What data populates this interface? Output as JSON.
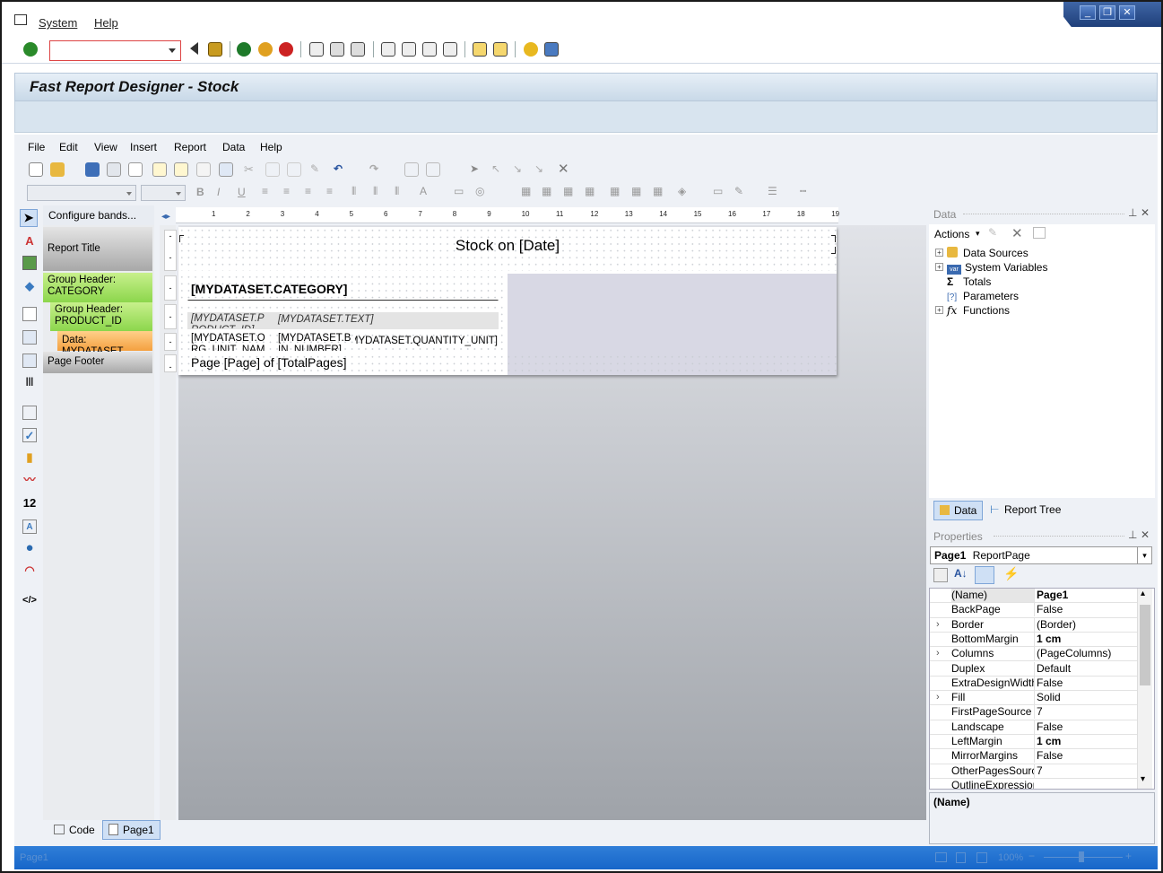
{
  "sap": {
    "menu": [
      "System",
      "Help"
    ],
    "command_field_value": ""
  },
  "window_title": "Fast Report Designer - Stock",
  "designer_menu": [
    "File",
    "Edit",
    "View",
    "Insert",
    "Report",
    "Data",
    "Help"
  ],
  "bands_header": "Configure bands...",
  "bands": [
    {
      "label": "Report Title"
    },
    {
      "label": "Group Header: CATEGORY"
    },
    {
      "label": "Group Header: PRODUCT_ID"
    },
    {
      "label": "Data: MYDATASET"
    },
    {
      "label": "Page Footer"
    }
  ],
  "ruler_numbers": [
    "1",
    "2",
    "3",
    "4",
    "5",
    "6",
    "7",
    "8",
    "9",
    "10",
    "11",
    "12",
    "13",
    "14",
    "15",
    "16",
    "17",
    "18",
    "19"
  ],
  "report": {
    "title_text": "Stock on [Date]",
    "category_text": "[MYDATASET.CATEGORY]",
    "product_id_text": "[MYDATASET.PRODUCT_ID]",
    "product_text": "[MYDATASET.TEXT]",
    "org_unit_text": "[MYDATASET.ORG_UNIT_NAME]",
    "bin_text": "[MYDATASET.BIN_NUMBER]",
    "qty_text": "[MYDATASET.QUANTITY_UNIT]",
    "footer_text": "Page [Page] of [TotalPages]"
  },
  "data_panel": {
    "title": "Data",
    "actions_label": "Actions",
    "tree": [
      "Data Sources",
      "System Variables",
      "Totals",
      "Parameters",
      "Functions"
    ],
    "tabs": [
      "Data",
      "Report Tree"
    ]
  },
  "properties_panel": {
    "title": "Properties",
    "selected_object": "Page1",
    "selected_type": "ReportPage",
    "rows": [
      {
        "name": "(Name)",
        "value": "Page1",
        "bold": true,
        "expand": false
      },
      {
        "name": "BackPage",
        "value": "False",
        "bold": false,
        "expand": false
      },
      {
        "name": "Border",
        "value": "(Border)",
        "bold": false,
        "expand": true
      },
      {
        "name": "BottomMargin",
        "value": "1 cm",
        "bold": true,
        "expand": false
      },
      {
        "name": "Columns",
        "value": "(PageColumns)",
        "bold": false,
        "expand": true
      },
      {
        "name": "Duplex",
        "value": "Default",
        "bold": false,
        "expand": false
      },
      {
        "name": "ExtraDesignWidth",
        "value": "False",
        "bold": false,
        "expand": false
      },
      {
        "name": "Fill",
        "value": "Solid",
        "bold": false,
        "expand": true
      },
      {
        "name": "FirstPageSource",
        "value": "7",
        "bold": false,
        "expand": false
      },
      {
        "name": "Landscape",
        "value": "False",
        "bold": false,
        "expand": false
      },
      {
        "name": "LeftMargin",
        "value": "1 cm",
        "bold": true,
        "expand": false
      },
      {
        "name": "MirrorMargins",
        "value": "False",
        "bold": false,
        "expand": false
      },
      {
        "name": "OtherPagesSource",
        "value": "7",
        "bold": false,
        "expand": false
      },
      {
        "name": "OutlineExpression",
        "value": "",
        "bold": false,
        "expand": false
      }
    ],
    "description_title": "(Name)"
  },
  "bottom_tabs": [
    "Code",
    "Page1"
  ],
  "status": {
    "left_text": "Page1",
    "zoom": "100%"
  }
}
